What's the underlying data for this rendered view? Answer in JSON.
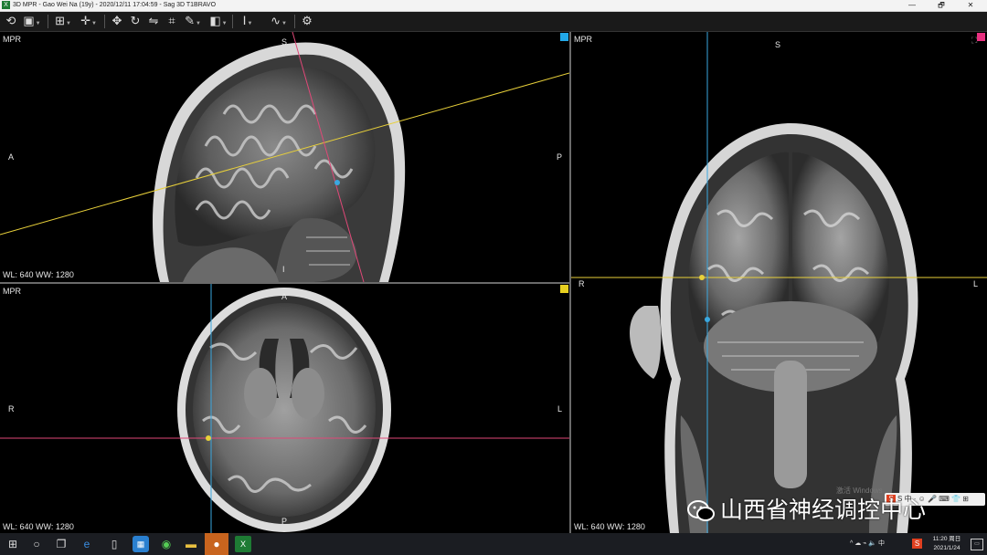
{
  "window": {
    "title": "3D MPR - Gao Wei Na (19y) - 2020/12/11 17:04:59 - Sag 3D T1BRAVO",
    "app_icon": "excel-like-app-icon",
    "controls": [
      "—",
      "🗗",
      "✕"
    ]
  },
  "toolbar": {
    "tools": [
      "sync-icon",
      "save-icon",
      "layout-icon",
      "crosshair-icon",
      "pan-icon",
      "rotate-icon",
      "flip-icon",
      "reformat-icon",
      "measure-icon",
      "contrast-icon",
      "slab-icon",
      "curve-icon",
      "settings-icon"
    ]
  },
  "viewports": {
    "sagittal": {
      "label": "MPR",
      "orient_top": "S",
      "orient_left": "A",
      "orient_right": "P",
      "orient_bottom": "I",
      "wlww": "WL: 640 WW: 1280",
      "marker_color": "#22a8e8"
    },
    "coronal": {
      "label": "MPR",
      "orient_top": "S",
      "orient_left": "R",
      "orient_right": "L",
      "wlww": "WL: 640 WW: 1280",
      "marker_color": "#e83080"
    },
    "axial": {
      "label": "MPR",
      "orient_top": "A",
      "orient_left": "R",
      "orient_right": "L",
      "orient_bottom": "P",
      "wlww": "WL: 640 WW: 1280",
      "marker_color": "#e8d020"
    },
    "line_colors": {
      "yellow": "#e8d03a",
      "blue": "#3aa8e0",
      "pink": "#e04878"
    }
  },
  "watermark": {
    "text": "山西省神经调控中心",
    "icon": "wechat-icon",
    "faint": "激活 Windows"
  },
  "ime": {
    "text": "S 中 · ☺ 🎤 ⌨ 👕 ⊞"
  },
  "taskbar": {
    "apps": [
      "windows-start-icon",
      "search-circle-icon",
      "task-view-icon",
      "edge-icon",
      "file-icon",
      "photos-icon",
      "360-icon",
      "folder-icon",
      "wechat-icon",
      "spreadsheet-icon"
    ],
    "tray": "^ ☁ ⌁ 🔈 中",
    "time": "11:20 周日",
    "date": "2021/1/24"
  }
}
